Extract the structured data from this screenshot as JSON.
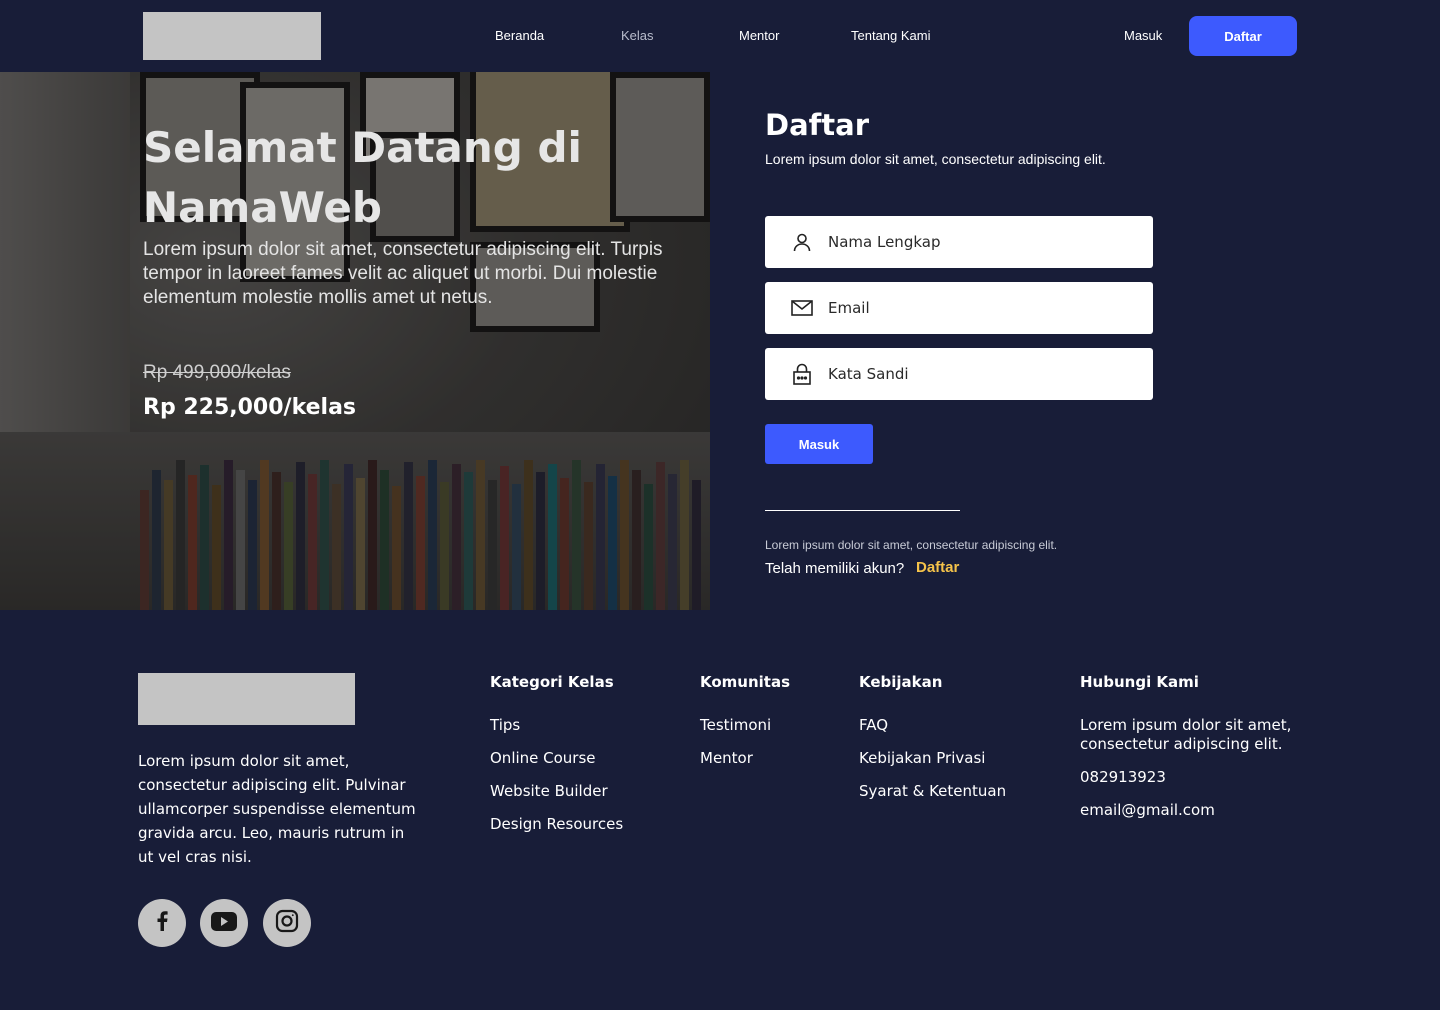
{
  "colors": {
    "background": "#181d38",
    "accent_blue": "#3d5afe",
    "link_yellow": "#f5c34a",
    "placeholder_grey": "#c4c4c4"
  },
  "nav": {
    "links": [
      {
        "label": "Beranda",
        "active": true
      },
      {
        "label": "Kelas",
        "active": false
      },
      {
        "label": "Mentor",
        "active": true
      },
      {
        "label": "Tentang Kami",
        "active": true
      }
    ],
    "login_label": "Masuk",
    "register_label": "Daftar"
  },
  "hero": {
    "title": "Selamat Datang di NamaWeb",
    "description": "Lorem ipsum dolor sit amet, consectetur adipiscing elit. Turpis tempor in laoreet fames velit ac aliquet ut morbi. Dui molestie elementum molestie mollis amet ut netus.",
    "price_old": "Rp 499,000/kelas",
    "price_new": "Rp 225,000/kelas"
  },
  "form": {
    "title": "Daftar",
    "subtitle": "Lorem ipsum dolor sit amet, consectetur adipiscing elit.",
    "name_placeholder": "Nama Lengkap",
    "email_placeholder": "Email",
    "password_placeholder": "Kata Sandi",
    "submit_label": "Masuk",
    "note": "Lorem ipsum dolor sit amet, consectetur adipiscing elit.",
    "have_account": "Telah memiliki akun?",
    "have_account_link": "Daftar"
  },
  "footer": {
    "description": "Lorem ipsum dolor sit amet, consectetur adipiscing elit. Pulvinar ullamcorper suspendisse elementum gravida arcu. Leo, mauris rutrum in ut vel cras nisi.",
    "social": [
      "facebook-icon",
      "youtube-icon",
      "instagram-icon"
    ],
    "columns": [
      {
        "title": "Kategori Kelas",
        "links": [
          "Tips",
          "Online Course",
          "Website Builder",
          "Design Resources"
        ]
      },
      {
        "title": "Komunitas",
        "links": [
          "Testimoni",
          "Mentor"
        ]
      },
      {
        "title": "Kebijakan",
        "links": [
          "FAQ",
          "Kebijakan Privasi",
          "Syarat & Ketentuan"
        ]
      }
    ],
    "contact": {
      "title": "Hubungi Kami",
      "address": "Lorem ipsum dolor sit amet, consectetur adipiscing elit.",
      "phone": "082913923",
      "email": "email@gmail.com"
    }
  }
}
